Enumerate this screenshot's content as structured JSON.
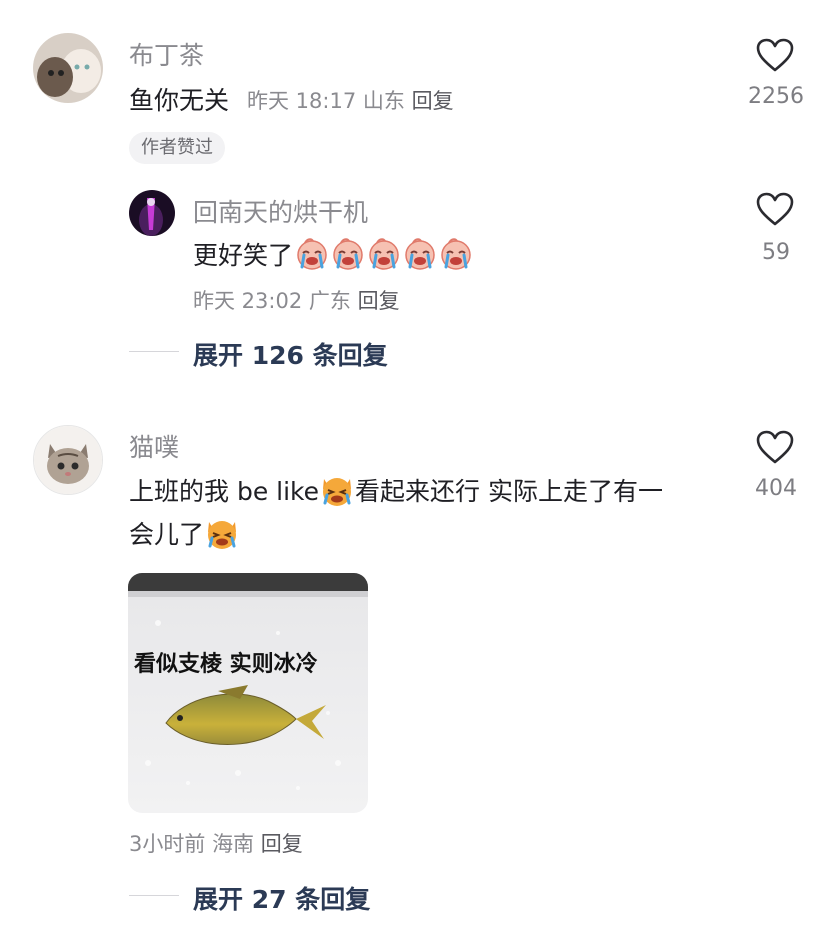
{
  "comments": [
    {
      "username": "布丁茶",
      "text": "鱼你无关",
      "time": "昨天 18:17",
      "location": "山东",
      "reply_label": "回复",
      "likes": "2256",
      "badge": "作者赞过",
      "replies": [
        {
          "username": "回南天的烘干机",
          "text": "更好笑了",
          "time": "昨天 23:02",
          "location": "广东",
          "reply_label": "回复",
          "likes": "59",
          "emoji": "crying-face-sticker"
        }
      ],
      "expand_label": "展开 126 条回复"
    },
    {
      "username": "猫噗",
      "text_part1": "上班的我 be like",
      "text_part2": "看起来还行 实际上走了有一",
      "text_part3": "会儿了",
      "emoji": "crying-cat-emoji",
      "image_caption": "看似支棱 实则冰冷",
      "time": "3小时前",
      "location": "海南",
      "reply_label": "回复",
      "likes": "404",
      "expand_label": "展开 27 条回复"
    }
  ],
  "colors": {
    "meta": "#8a8a8f",
    "expand": "#2b3a55",
    "badge_bg": "#f2f2f4"
  }
}
